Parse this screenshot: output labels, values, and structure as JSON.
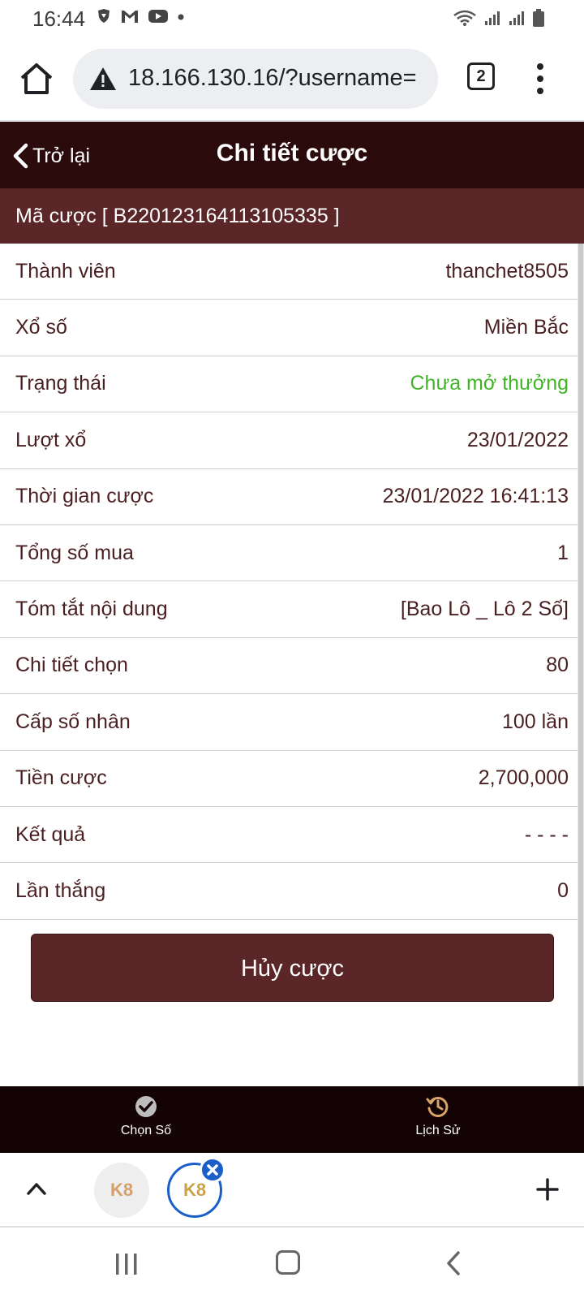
{
  "status_bar": {
    "time": "16:44"
  },
  "browser": {
    "url": "18.166.130.16/?username=",
    "tab_count": "2"
  },
  "header": {
    "back_label": "Trở lại",
    "title": "Chi tiết cược"
  },
  "bet_code": "Mã cược [ B220123164113105335 ]",
  "details": [
    {
      "label": "Thành viên",
      "value": "thanchet8505"
    },
    {
      "label": "Xổ số",
      "value": "Miền Bắc"
    },
    {
      "label": "Trạng thái",
      "value": "Chưa mở thưởng"
    },
    {
      "label": "Lượt xổ",
      "value": "23/01/2022"
    },
    {
      "label": "Thời gian cược",
      "value": "23/01/2022 16:41:13"
    },
    {
      "label": "Tổng số mua",
      "value": "1"
    },
    {
      "label": "Tóm tắt nội dung",
      "value": "[Bao Lô _ Lô 2 Số]"
    },
    {
      "label": "Chi tiết chọn",
      "value": "80"
    },
    {
      "label": "Cấp số nhân",
      "value": "100 lần"
    },
    {
      "label": "Tiền cược",
      "value": "2,700,000"
    },
    {
      "label": "Kết quả",
      "value": "- - - -"
    },
    {
      "label": "Lần thắng",
      "value": "0"
    }
  ],
  "cancel_button": "Hủy cược",
  "bottom_nav": {
    "choose_label": "Chọn Số",
    "history_label": "Lịch Sử"
  },
  "tab_strip": {
    "tab1_label": "K8",
    "tab2_label": "K8"
  },
  "colors": {
    "header_bg": "#2b0a0b",
    "accent": "#5a2628",
    "status_green": "#3fb526",
    "nav_bg": "#140304"
  }
}
